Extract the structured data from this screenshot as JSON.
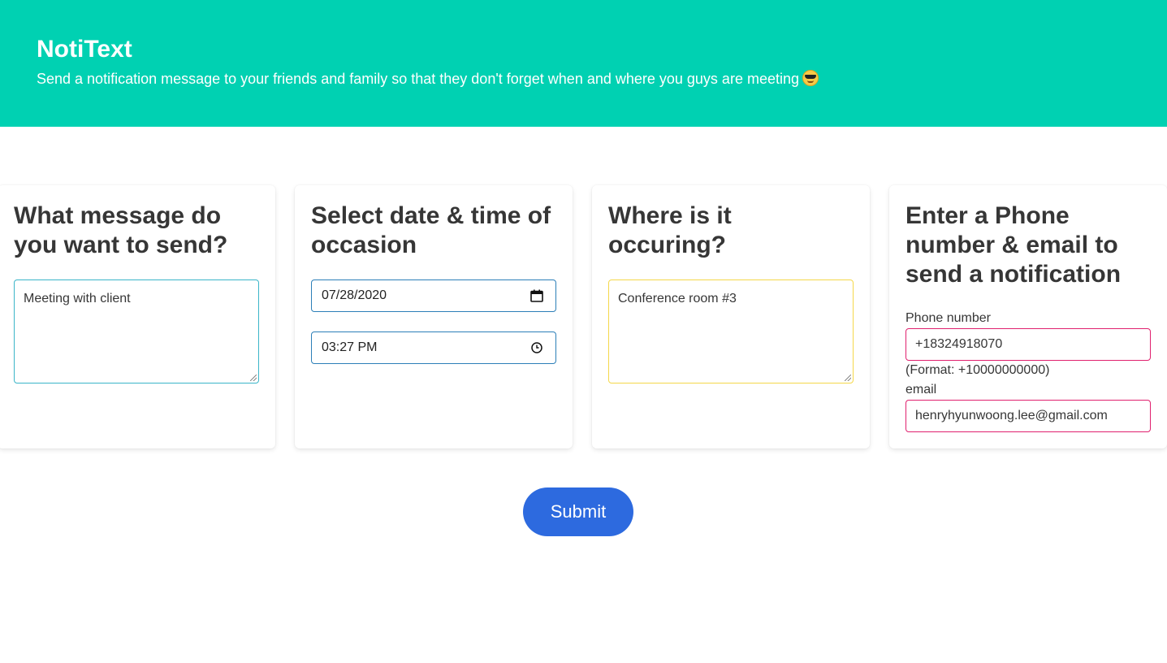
{
  "hero": {
    "title": "NotiText",
    "subtitle": "Send a notification message to your friends and family so that they don't forget when and where you guys are meeting",
    "emoji_icon": "smiling-face-with-sunglasses"
  },
  "cards": {
    "message": {
      "heading": "What message do you want to send?",
      "value": "Meeting with client",
      "border_color": "#3bb5c8"
    },
    "datetime": {
      "heading": "Select date & time of occasion",
      "date_value": "07/28/2020",
      "time_value": "03:27 PM",
      "date_icon": "calendar-icon",
      "time_icon": "clock-icon",
      "border_color": "#2c7fb8"
    },
    "location": {
      "heading": "Where is it occuring?",
      "value": "Conference room #3",
      "border_color": "#f5d84a"
    },
    "contact": {
      "heading": "Enter a Phone number & email to send a notification",
      "phone_label": "Phone number",
      "phone_value": "+18324918070",
      "phone_hint": "(Format: +10000000000)",
      "email_label": "email",
      "email_value": "henryhyunwoong.lee@gmail.com",
      "border_color": "#e0206e"
    }
  },
  "submit_label": "Submit",
  "colors": {
    "hero": "#00d1b2",
    "submit": "#2d6adf"
  }
}
